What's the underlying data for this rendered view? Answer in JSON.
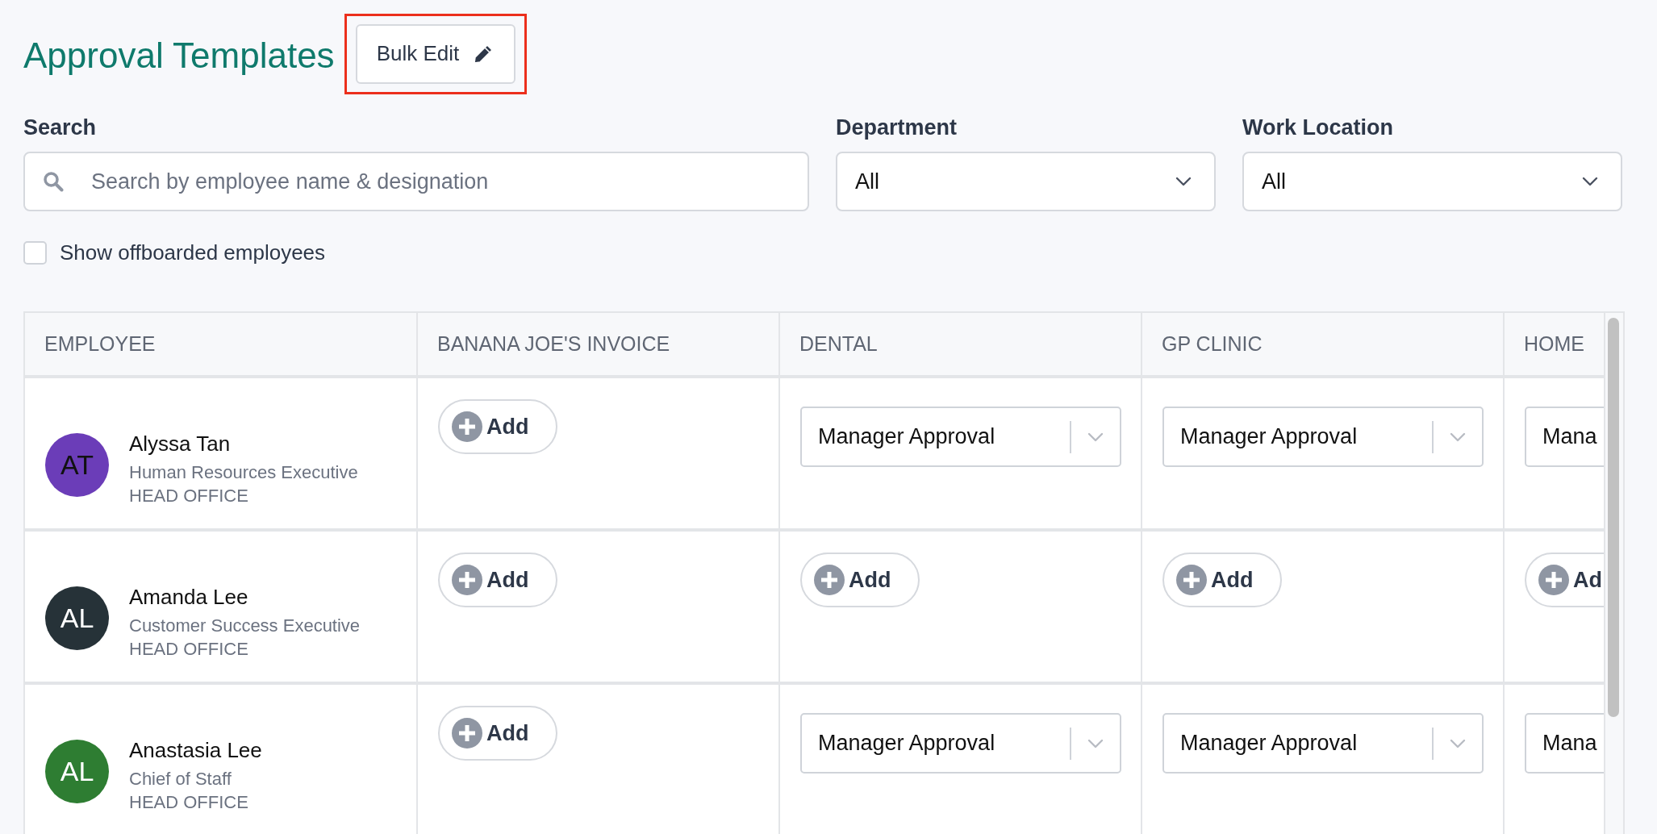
{
  "title": "Approval Templates",
  "bulk_edit": {
    "label": "Bulk Edit",
    "highlighted": true
  },
  "filters": {
    "search": {
      "label": "Search",
      "placeholder": "Search by employee name & designation"
    },
    "department": {
      "label": "Department",
      "value": "All"
    },
    "work_location": {
      "label": "Work Location",
      "value": "All"
    }
  },
  "show_offboarded": {
    "label": "Show offboarded employees",
    "checked": false
  },
  "table": {
    "columns": [
      "EMPLOYEE",
      "BANANA JOE'S INVOICE",
      "DENTAL",
      "GP CLINIC",
      "HOME"
    ],
    "rows": [
      {
        "cells": [
          {
            "kind": "employee",
            "initials": "AT",
            "color": "#6b3db8",
            "name": "Alyssa Tan",
            "designation": "Human Resources Executive",
            "location": "HEAD OFFICE"
          },
          {
            "kind": "add",
            "label": "Add"
          },
          {
            "kind": "select",
            "value": "Manager Approval"
          },
          {
            "kind": "select",
            "value": "Manager Approval"
          },
          {
            "kind": "select",
            "value": "Mana"
          }
        ]
      },
      {
        "cells": [
          {
            "kind": "employee",
            "initials": "AL",
            "color": "#263238",
            "name": "Amanda Lee",
            "designation": "Customer Success Executive",
            "location": "HEAD OFFICE"
          },
          {
            "kind": "add",
            "label": "Add"
          },
          {
            "kind": "add",
            "label": "Add"
          },
          {
            "kind": "add",
            "label": "Add"
          },
          {
            "kind": "add",
            "label": "Ad"
          }
        ]
      },
      {
        "cells": [
          {
            "kind": "employee",
            "initials": "AL",
            "color": "#2e7d32",
            "name": "Anastasia Lee",
            "designation": "Chief of Staff",
            "location": "HEAD OFFICE"
          },
          {
            "kind": "add",
            "label": "Add"
          },
          {
            "kind": "select",
            "value": "Manager Approval"
          },
          {
            "kind": "select",
            "value": "Manager Approval"
          },
          {
            "kind": "select",
            "value": "Mana"
          }
        ]
      }
    ]
  }
}
